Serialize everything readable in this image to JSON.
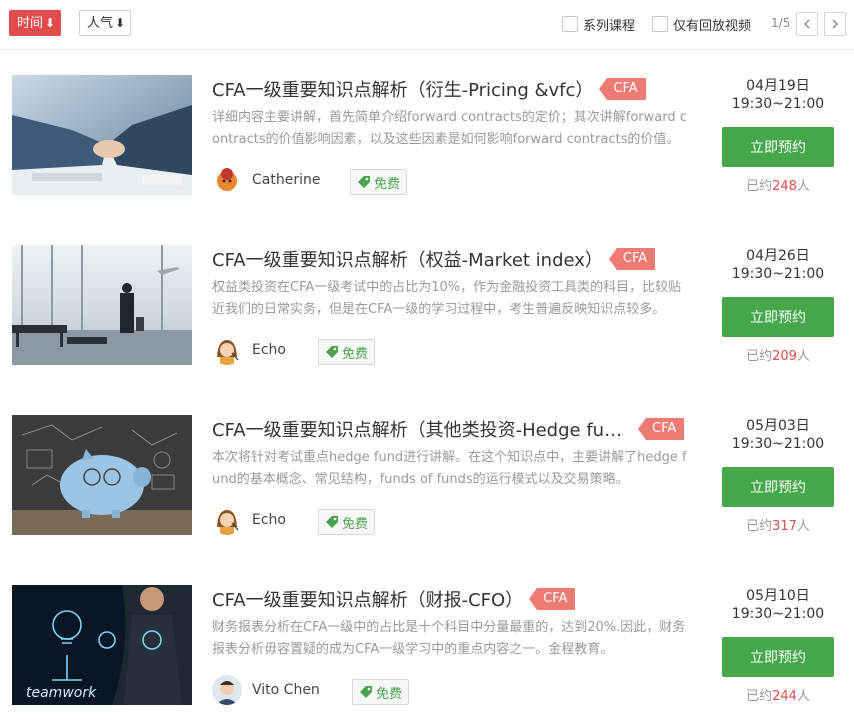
{
  "toolbar": {
    "sort_time_label": "时间",
    "sort_popular_label": "人气",
    "sort_arrow": "⬇",
    "filter_series_label": "系列课程",
    "filter_replay_label": "仅有回放视频",
    "page_indicator": "1/5"
  },
  "courses": [
    {
      "title": "CFA一级重要知识点解析（衍生-Pricing &vfc）",
      "tag": "CFA",
      "description": "详细内容主要讲解，首先简单介绍forward contracts的定价；其次讲解forward contracts的价值影响因素，以及这些因素是如何影响forward contracts的价值。",
      "teacher": "Catherine",
      "free_label": "免费",
      "date": "04月19日",
      "time": "19:30~21:00",
      "button": "立即预约",
      "booked_prefix": "已约",
      "booked_count": "248",
      "booked_suffix": "人"
    },
    {
      "title": "CFA一级重要知识点解析（权益-Market index）",
      "tag": "CFA",
      "description": "权益类投资在CFA一级考试中的占比为10%，作为金融投资工具类的科目，比较贴近我们的日常实务，但是在CFA一级的学习过程中，考生普遍反映知识点较多。",
      "teacher": "Echo",
      "free_label": "免费",
      "date": "04月26日",
      "time": "19:30~21:00",
      "button": "立即预约",
      "booked_prefix": "已约",
      "booked_count": "209",
      "booked_suffix": "人"
    },
    {
      "title": "CFA一级重要知识点解析（其他类投资-Hedge fund）",
      "tag": "CFA",
      "description": "本次将针对考试重点hedge fund进行讲解。在这个知识点中，主要讲解了hedge fund的基本概念、常见结构，funds of funds的运行模式以及交易策略。",
      "teacher": "Echo",
      "free_label": "免费",
      "date": "05月03日",
      "time": "19:30~21:00",
      "button": "立即预约",
      "booked_prefix": "已约",
      "booked_count": "317",
      "booked_suffix": "人"
    },
    {
      "title": "CFA一级重要知识点解析（财报-CFO）",
      "tag": "CFA",
      "description": "财务报表分析在CFA一级中的占比是十个科目中分量最重的，达到20%.因此，财务报表分析毋容置疑的成为CFA一级学习中的重点内容之一。金程教育。",
      "teacher": "Vito Chen",
      "free_label": "免费",
      "date": "05月10日",
      "time": "19:30~21:00",
      "button": "立即预约",
      "booked_prefix": "已约",
      "booked_count": "244",
      "booked_suffix": "人"
    }
  ],
  "thumb_text": {
    "teamwork": "teamwork"
  },
  "colors": {
    "accent_red": "#e04b4b",
    "tag_bg": "#ee7a74",
    "button_green": "#45a74a",
    "free_green": "#49a34e"
  }
}
